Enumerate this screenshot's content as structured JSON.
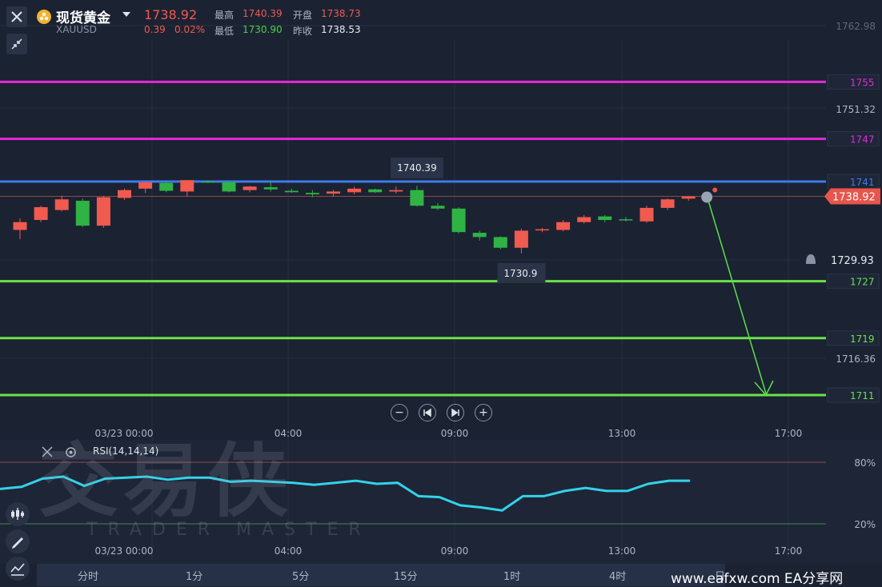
{
  "header": {
    "symbol_name": "现货黄金",
    "symbol_code": "XAUUSD",
    "last_price": "1738.92",
    "change": "0.39",
    "change_pct": "0.02%",
    "high_label": "最高",
    "high_value": "1740.39",
    "open_label": "开盘",
    "open_value": "1738.73",
    "low_label": "最低",
    "low_value": "1730.90",
    "prev_close_label": "昨收",
    "prev_close_value": "1738.53"
  },
  "rsi_panel": {
    "indicator_label": "RSI(14,14,14)"
  },
  "timeframes": [
    "分时",
    "1分",
    "5分",
    "15分",
    "1时",
    "4时",
    "日"
  ],
  "brand": "www.eafxw.com  EA分享网",
  "watermark": {
    "main": "交易侠",
    "sub": "TRADER MASTER"
  },
  "colors": {
    "up": "#f05a4f",
    "down": "#2fb344",
    "magenta": "#e42ad8",
    "blue": "#3c7be8",
    "green_line": "#69e24a",
    "rsi": "#33d2ea"
  },
  "chart_data": [
    {
      "type": "candlestick",
      "x_tick_labels": [
        "03/23 00:00",
        "04:00",
        "09:00",
        "13:00",
        "17:00"
      ],
      "y_tick_labels": [
        "1762.98",
        "1751.32",
        "1729.93",
        "1716.36"
      ],
      "ylim": [
        1708,
        1766
      ],
      "annotations": {
        "high_marker": "1740.39",
        "low_marker": "1730.9",
        "current_price": "1738.92",
        "alert_price": "1729.93"
      },
      "levels": [
        {
          "value": 1755,
          "label": "1755",
          "color": "#e42ad8"
        },
        {
          "value": 1747,
          "label": "1747",
          "color": "#e42ad8"
        },
        {
          "value": 1741,
          "label": "1741",
          "color": "#3c7be8"
        },
        {
          "value": 1727,
          "label": "1727",
          "color": "#69e24a"
        },
        {
          "value": 1719,
          "label": "1719",
          "color": "#69e24a"
        },
        {
          "value": 1711,
          "label": "1711",
          "color": "#69e24a"
        }
      ],
      "candles": [
        {
          "o": 1734.2,
          "h": 1735.8,
          "l": 1732.9,
          "c": 1735.3
        },
        {
          "o": 1735.6,
          "h": 1737.6,
          "l": 1735.3,
          "c": 1737.4
        },
        {
          "o": 1737.0,
          "h": 1739.0,
          "l": 1736.8,
          "c": 1738.5
        },
        {
          "o": 1738.3,
          "h": 1738.6,
          "l": 1734.6,
          "c": 1734.8
        },
        {
          "o": 1734.8,
          "h": 1739.0,
          "l": 1734.5,
          "c": 1738.8
        },
        {
          "o": 1738.7,
          "h": 1740.0,
          "l": 1738.4,
          "c": 1739.8
        },
        {
          "o": 1740.0,
          "h": 1741.0,
          "l": 1739.4,
          "c": 1740.9
        },
        {
          "o": 1740.8,
          "h": 1741.1,
          "l": 1739.5,
          "c": 1739.7
        },
        {
          "o": 1739.6,
          "h": 1741.1,
          "l": 1738.9,
          "c": 1741.2
        },
        {
          "o": 1741.0,
          "h": 1741.2,
          "l": 1740.8,
          "c": 1740.9
        },
        {
          "o": 1740.9,
          "h": 1741.1,
          "l": 1739.5,
          "c": 1739.6
        },
        {
          "o": 1739.8,
          "h": 1740.4,
          "l": 1739.5,
          "c": 1740.3
        },
        {
          "o": 1740.2,
          "h": 1741.0,
          "l": 1739.6,
          "c": 1739.9
        },
        {
          "o": 1739.7,
          "h": 1740.0,
          "l": 1739.4,
          "c": 1739.5
        },
        {
          "o": 1739.4,
          "h": 1739.8,
          "l": 1738.8,
          "c": 1739.2
        },
        {
          "o": 1739.3,
          "h": 1739.8,
          "l": 1738.9,
          "c": 1739.6
        },
        {
          "o": 1739.5,
          "h": 1740.3,
          "l": 1739.2,
          "c": 1740.0
        },
        {
          "o": 1739.9,
          "h": 1740.0,
          "l": 1739.4,
          "c": 1739.5
        },
        {
          "o": 1739.6,
          "h": 1740.3,
          "l": 1739.3,
          "c": 1739.8
        },
        {
          "o": 1739.8,
          "h": 1740.4,
          "l": 1737.5,
          "c": 1737.6
        },
        {
          "o": 1737.6,
          "h": 1738.0,
          "l": 1737.0,
          "c": 1737.2
        },
        {
          "o": 1737.2,
          "h": 1737.4,
          "l": 1733.7,
          "c": 1733.9
        },
        {
          "o": 1733.8,
          "h": 1734.1,
          "l": 1732.7,
          "c": 1733.2
        },
        {
          "o": 1733.2,
          "h": 1733.3,
          "l": 1731.5,
          "c": 1731.7
        },
        {
          "o": 1731.7,
          "h": 1734.4,
          "l": 1730.9,
          "c": 1734.1
        },
        {
          "o": 1734.2,
          "h": 1734.5,
          "l": 1733.9,
          "c": 1734.3
        },
        {
          "o": 1734.2,
          "h": 1735.6,
          "l": 1734.0,
          "c": 1735.3
        },
        {
          "o": 1735.3,
          "h": 1736.3,
          "l": 1735.1,
          "c": 1736.0
        },
        {
          "o": 1736.1,
          "h": 1736.3,
          "l": 1735.3,
          "c": 1735.6
        },
        {
          "o": 1735.7,
          "h": 1736.0,
          "l": 1735.4,
          "c": 1735.6
        },
        {
          "o": 1735.4,
          "h": 1737.6,
          "l": 1735.2,
          "c": 1737.3
        },
        {
          "o": 1737.3,
          "h": 1738.6,
          "l": 1737.0,
          "c": 1738.5
        },
        {
          "o": 1738.6,
          "h": 1739.0,
          "l": 1738.3,
          "c": 1738.9
        }
      ]
    },
    {
      "type": "line",
      "title": "RSI(14,14,14)",
      "y_tick_labels": [
        "80%",
        "20%"
      ],
      "ylim": [
        0,
        100
      ],
      "x_tick_labels": [
        "03/23 00:00",
        "04:00",
        "09:00",
        "13:00",
        "17:00"
      ],
      "series": [
        {
          "values": [
            54,
            56,
            64,
            66,
            57,
            64,
            65,
            66,
            63,
            65,
            65,
            61,
            62,
            61,
            60,
            58,
            60,
            62,
            59,
            60,
            47,
            46,
            38,
            36,
            33,
            47,
            47,
            52,
            55,
            52,
            52,
            59,
            62,
            62
          ]
        }
      ]
    }
  ]
}
